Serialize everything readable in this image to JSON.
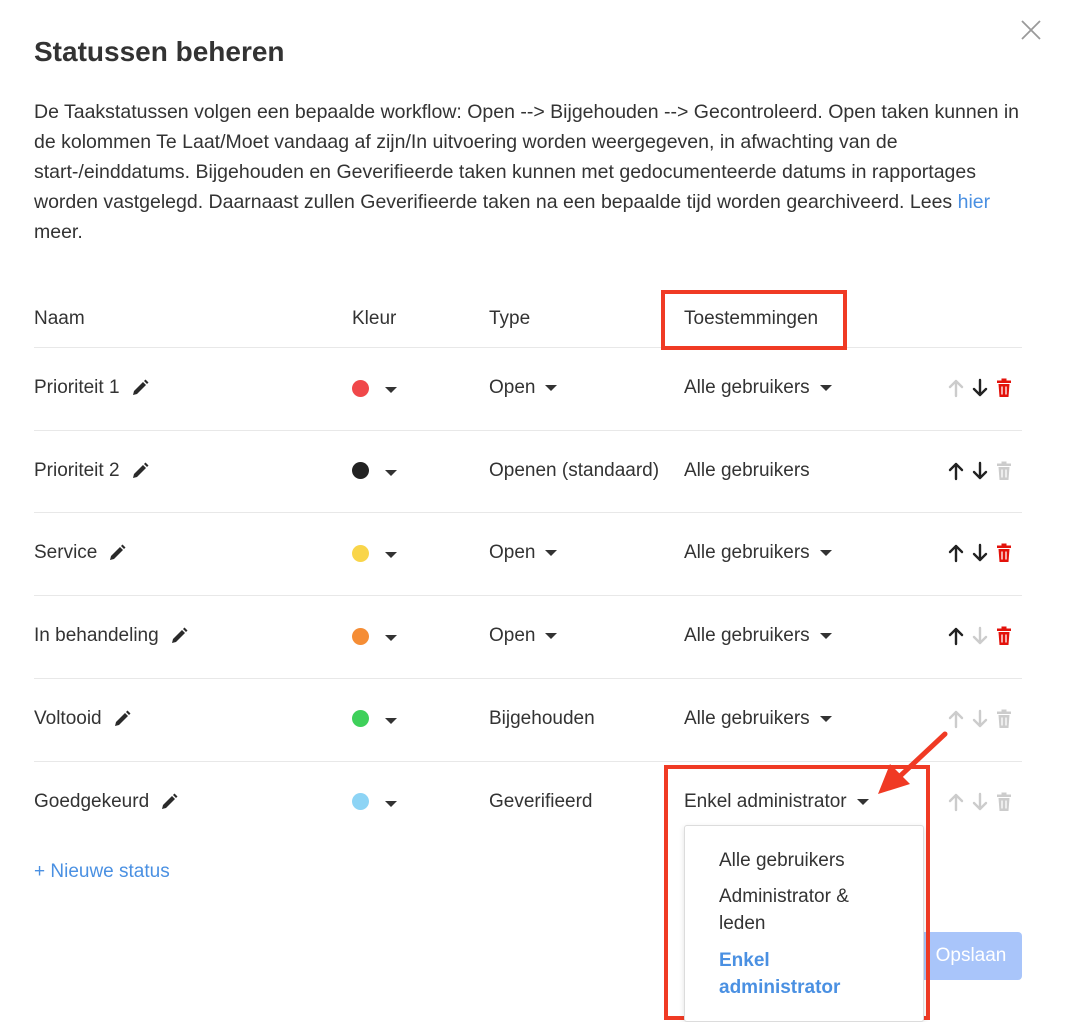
{
  "dialog": {
    "title": "Statussen beheren",
    "description_before": "De Taakstatussen volgen een bepaalde workflow: Open --> Bijgehouden --> Gecontroleerd. Open taken kunnen in de kolommen Te Laat/Moet vandaag af zijn/In uitvoering worden weergegeven, in afwachting van de start-/einddatums. Bijgehouden en Geverifieerde taken kunnen met gedocumenteerde datums in rapportages worden vastgelegd. Daarnaast zullen Geverifieerde taken na een bepaalde tijd worden gearchiveerd. Lees ",
    "description_link": "hier",
    "description_after": " meer."
  },
  "table": {
    "headers": {
      "name": "Naam",
      "color": "Kleur",
      "type": "Type",
      "permissions": "Toestemmingen"
    },
    "rows": [
      {
        "name": "Prioriteit 1",
        "color": "#f0484a",
        "type": "Open",
        "type_dropdown": true,
        "permission": "Alle gebruikers",
        "perm_dropdown": true,
        "up_enabled": false,
        "down_enabled": true,
        "delete_enabled": true
      },
      {
        "name": "Prioriteit 2",
        "color": "#222222",
        "type": "Openen (standaard)",
        "type_dropdown": false,
        "permission": "Alle gebruikers",
        "perm_dropdown": false,
        "up_enabled": true,
        "down_enabled": true,
        "delete_enabled": false
      },
      {
        "name": "Service",
        "color": "#f9d54a",
        "type": "Open",
        "type_dropdown": true,
        "permission": "Alle gebruikers",
        "perm_dropdown": true,
        "up_enabled": true,
        "down_enabled": true,
        "delete_enabled": true
      },
      {
        "name": "In behandeling",
        "color": "#f58d35",
        "type": "Open",
        "type_dropdown": true,
        "permission": "Alle gebruikers",
        "perm_dropdown": true,
        "up_enabled": true,
        "down_enabled": false,
        "delete_enabled": true
      },
      {
        "name": "Voltooid",
        "color": "#3ed05a",
        "type": "Bijgehouden",
        "type_dropdown": false,
        "permission": "Alle gebruikers",
        "perm_dropdown": true,
        "up_enabled": false,
        "down_enabled": false,
        "delete_enabled": false
      },
      {
        "name": "Goedgekeurd",
        "color": "#8dd4f5",
        "type": "Geverifieerd",
        "type_dropdown": false,
        "permission": "Enkel administrator",
        "perm_dropdown": true,
        "up_enabled": false,
        "down_enabled": false,
        "delete_enabled": false
      }
    ]
  },
  "new_status_label": "+ Nieuwe status",
  "save_label": "Opslaan",
  "permission_menu": {
    "options": [
      "Alle gebruikers",
      "Administrator & leden",
      "Enkel administrator"
    ],
    "selected": "Enkel administrator"
  },
  "colors": {
    "accent": "#4a90e2",
    "danger": "#e3120b",
    "highlight": "#f03a24",
    "disabled": "#cccccc",
    "save_bg": "#a9c5fa"
  }
}
